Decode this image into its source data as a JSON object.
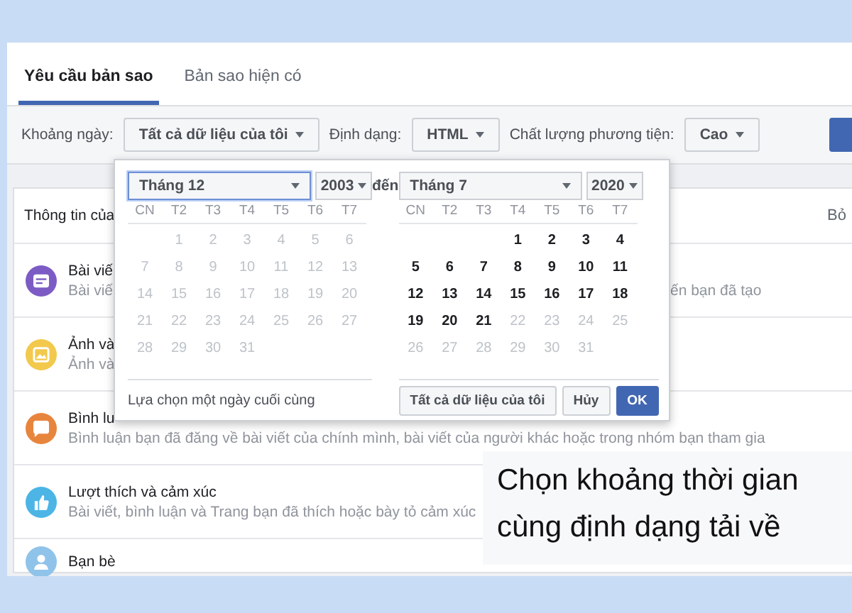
{
  "tabs": [
    {
      "label": "Yêu cầu bản sao",
      "selected": true
    },
    {
      "label": "Bản sao hiện có",
      "selected": false
    }
  ],
  "filters": [
    {
      "label": "Khoảng ngày:",
      "value": "Tất cả dữ liệu của tôi"
    },
    {
      "label": "Định dạng:",
      "value": "HTML"
    },
    {
      "label": "Chất lượng phương tiện:",
      "value": "Cao"
    }
  ],
  "section": {
    "header": "Thông tin của",
    "header_right": "Bỏ",
    "items": [
      {
        "title": "Bài viế",
        "subtitle": "Bài viế",
        "subtitle_tail": "ến bạn đã tạo",
        "color": "#7c5cc4"
      },
      {
        "title": "Ảnh và",
        "subtitle": "Ảnh và",
        "color": "#f2c94c"
      },
      {
        "title": "Bình lu",
        "subtitle": "Bình luận bạn đã đăng về bài viết của chính mình, bài viết của người khác hoặc trong nhóm bạn tham gia",
        "color": "#e8853d"
      },
      {
        "title": "Lượt thích và cảm xúc",
        "subtitle": "Bài viết, bình luận và Trang bạn đã thích hoặc bày tỏ cảm xúc",
        "color": "#4cb5e5"
      },
      {
        "title": "Bạn bè",
        "color": "#8fc3ea"
      }
    ]
  },
  "date_picker": {
    "separator": "đến",
    "hint": "Lựa chọn một ngày cuối cùng",
    "calendars": [
      {
        "month": "Tháng 12",
        "year": "2003",
        "focused": true,
        "weekdays": [
          "CN",
          "T2",
          "T3",
          "T4",
          "T5",
          "T6",
          "T7"
        ],
        "weeks": [
          [
            {
              "day": "1",
              "disabled": true
            },
            {
              "day": "2",
              "disabled": true
            },
            {
              "day": "3",
              "disabled": true
            },
            {
              "day": "4",
              "disabled": true
            },
            {
              "day": "5",
              "disabled": true
            },
            {
              "day": "6",
              "disabled": true
            }
          ],
          [
            {
              "day": "7",
              "disabled": true
            },
            {
              "day": "8",
              "disabled": true
            },
            {
              "day": "9",
              "disabled": true
            },
            {
              "day": "10",
              "disabled": true
            },
            {
              "day": "11",
              "disabled": true
            },
            {
              "day": "12",
              "disabled": true
            },
            {
              "day": "13",
              "disabled": true
            }
          ],
          [
            {
              "day": "14",
              "disabled": true
            },
            {
              "day": "15",
              "disabled": true
            },
            {
              "day": "16",
              "disabled": true
            },
            {
              "day": "17",
              "disabled": true
            },
            {
              "day": "18",
              "disabled": true
            },
            {
              "day": "19",
              "disabled": true
            },
            {
              "day": "20",
              "disabled": true
            }
          ],
          [
            {
              "day": "21",
              "disabled": true
            },
            {
              "day": "22",
              "disabled": true
            },
            {
              "day": "23",
              "disabled": true
            },
            {
              "day": "24",
              "disabled": true
            },
            {
              "day": "25",
              "disabled": true
            },
            {
              "day": "26",
              "disabled": true
            },
            {
              "day": "27",
              "disabled": true
            }
          ],
          [
            {
              "day": "28",
              "disabled": true
            },
            {
              "day": "29",
              "disabled": true
            },
            {
              "day": "30",
              "disabled": true
            },
            {
              "day": "31",
              "disabled": true
            }
          ]
        ]
      },
      {
        "month": "Tháng 7",
        "year": "2020",
        "focused": false,
        "weekdays": [
          "CN",
          "T2",
          "T3",
          "T4",
          "T5",
          "T6",
          "T7"
        ],
        "weeks": [
          [
            {
              "day": "1",
              "disabled": false
            },
            {
              "day": "2",
              "disabled": false
            },
            {
              "day": "3",
              "disabled": false
            },
            {
              "day": "4",
              "disabled": false
            }
          ],
          [
            {
              "day": "5",
              "disabled": false
            },
            {
              "day": "6",
              "disabled": false
            },
            {
              "day": "7",
              "disabled": false
            },
            {
              "day": "8",
              "disabled": false
            },
            {
              "day": "9",
              "disabled": false
            },
            {
              "day": "10",
              "disabled": false
            },
            {
              "day": "11",
              "disabled": false
            }
          ],
          [
            {
              "day": "12",
              "disabled": false
            },
            {
              "day": "13",
              "disabled": false
            },
            {
              "day": "14",
              "disabled": false
            },
            {
              "day": "15",
              "disabled": false
            },
            {
              "day": "16",
              "disabled": false
            },
            {
              "day": "17",
              "disabled": false
            },
            {
              "day": "18",
              "disabled": false
            }
          ],
          [
            {
              "day": "19",
              "disabled": false
            },
            {
              "day": "20",
              "disabled": false
            },
            {
              "day": "21",
              "disabled": false
            },
            {
              "day": "22",
              "disabled": true
            },
            {
              "day": "23",
              "disabled": true
            },
            {
              "day": "24",
              "disabled": true
            },
            {
              "day": "25",
              "disabled": true
            }
          ],
          [
            {
              "day": "26",
              "disabled": true
            },
            {
              "day": "27",
              "disabled": true
            },
            {
              "day": "28",
              "disabled": true
            },
            {
              "day": "29",
              "disabled": true
            },
            {
              "day": "30",
              "disabled": true
            },
            {
              "day": "31",
              "disabled": true
            }
          ]
        ]
      }
    ],
    "buttons": [
      {
        "label": "Tất cả dữ liệu của tôi",
        "kind": "default"
      },
      {
        "label": "Hủy",
        "kind": "default"
      },
      {
        "label": "OK",
        "kind": "primary"
      }
    ]
  },
  "caption": {
    "lines": [
      "Chọn khoảng thời gian",
      "cùng định dạng tải về"
    ]
  }
}
